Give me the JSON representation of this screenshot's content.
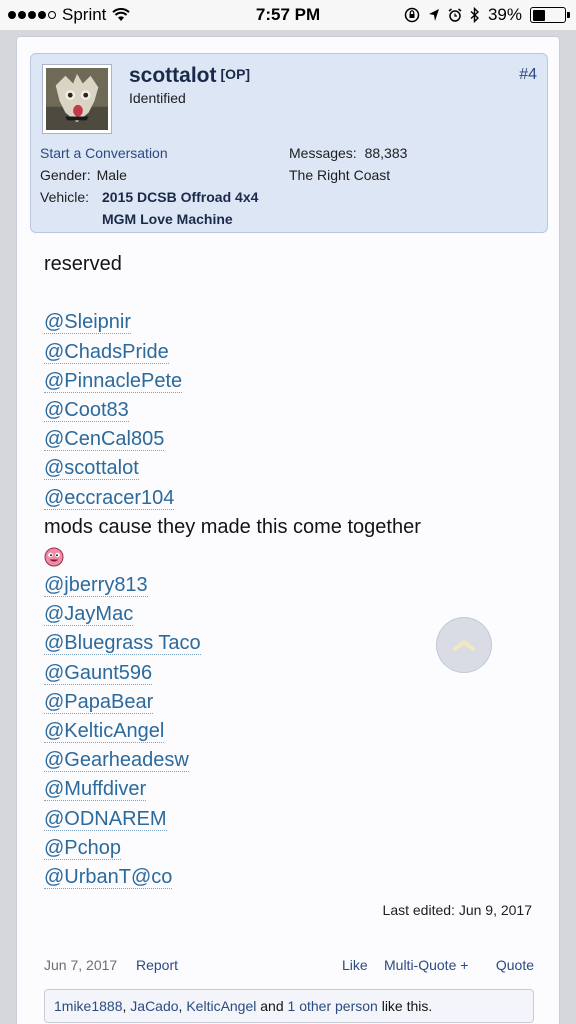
{
  "status_bar": {
    "carrier": "Sprint",
    "time": "7:57 PM",
    "battery": "39%",
    "battery_level": 0.39
  },
  "post": {
    "username": "scottalot",
    "op_badge": "[OP]",
    "user_title": "Identified",
    "post_number": "#4",
    "start_conversation": "Start a Conversation",
    "gender_label": "Gender:",
    "gender_value": "Male",
    "vehicle_label": "Vehicle:",
    "vehicle_value_line1": "2015 DCSB Offroad 4x4",
    "vehicle_value_line2": "MGM Love Machine",
    "messages_label": "Messages:",
    "messages_value": "88,383",
    "location": "The Right Coast",
    "body_intro": "reserved",
    "mentions_group1": [
      "@Sleipnir",
      "@ChadsPride",
      "@PinnaclePete",
      "@Coot83",
      "@CenCal805",
      "@scottalot",
      "@eccracer104"
    ],
    "mods_text": "mods cause they made this come together",
    "mentions_group2": [
      "@jberry813",
      "@JayMac",
      "@Bluegrass Taco",
      "@Gaunt596",
      "@PapaBear",
      "@KelticAngel",
      "@Gearheadesw",
      "@Muffdiver",
      "@ODNAREM",
      "@Pchop",
      "@UrbanT@co"
    ],
    "last_edited": "Last edited: Jun 9, 2017",
    "date": "Jun 7, 2017",
    "report": "Report",
    "like": "Like",
    "multi_quote": "Multi-Quote +",
    "quote": "Quote",
    "likes": {
      "user1": "1mike1888",
      "sep1": ", ",
      "user2": "JaCado",
      "sep2": ", ",
      "user3": "KelticAngel",
      "and": " and ",
      "others": "1 other person",
      "suffix": " like this."
    }
  },
  "colors": {
    "link": "#2c6a9c",
    "userbox_bg": "#dce6f4",
    "username": "#1b2a4a"
  }
}
